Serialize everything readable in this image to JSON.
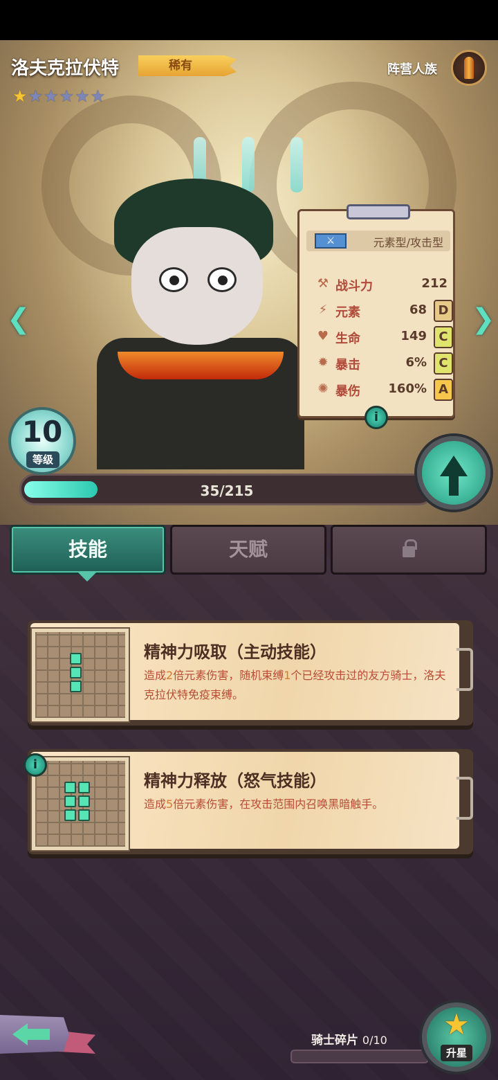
{
  "hero": {
    "name": "洛夫克拉伏特",
    "rarity": "稀有",
    "stars": {
      "filled": 1,
      "total": 6
    },
    "faction_label": "阵营人族",
    "faction_icon": "bullet-icon"
  },
  "stats_card": {
    "type_label": "元素型/攻击型",
    "type_icon": "blade-icon",
    "stats": [
      {
        "icon": "power-icon",
        "label": "战斗力",
        "value": "212",
        "grade": ""
      },
      {
        "icon": "lightning-icon",
        "label": "元素",
        "value": "68",
        "grade": "D"
      },
      {
        "icon": "heart-icon",
        "label": "生命",
        "value": "149",
        "grade": "C"
      },
      {
        "icon": "crit-icon",
        "label": "暴击",
        "value": "6%",
        "grade": "C"
      },
      {
        "icon": "crit-damage-icon",
        "label": "暴伤",
        "value": "160%",
        "grade": "A"
      }
    ]
  },
  "level": {
    "value": "10",
    "label": "等级",
    "xp_text": "35/215",
    "xp_current": 35,
    "xp_max": 215
  },
  "tabs": [
    {
      "label": "技能",
      "active": true
    },
    {
      "label": "天赋",
      "active": false
    },
    {
      "label": "",
      "locked": true
    }
  ],
  "skills": [
    {
      "title": "精神力吸取（主动技能）",
      "desc_parts": [
        "造成",
        "2",
        "倍元素伤害，随机束缚",
        "1",
        "个已经攻击过的友方骑士，洛夫克拉伏特免疫束缚。"
      ]
    },
    {
      "title": "精神力释放（怒气技能）",
      "desc_parts": [
        "造成",
        "5",
        "倍元素伤害，在攻击范围内召唤黑暗触手。"
      ]
    }
  ],
  "footer": {
    "shards_label": "骑士碎片",
    "shards_count": "0/10",
    "star_up_label": "升星"
  },
  "colors": {
    "accent_teal": "#2cc8b0",
    "grade_d": "#e6c889",
    "grade_c": "#dfe56c",
    "grade_a": "#f6c74b",
    "star_gold": "#f7c531"
  }
}
